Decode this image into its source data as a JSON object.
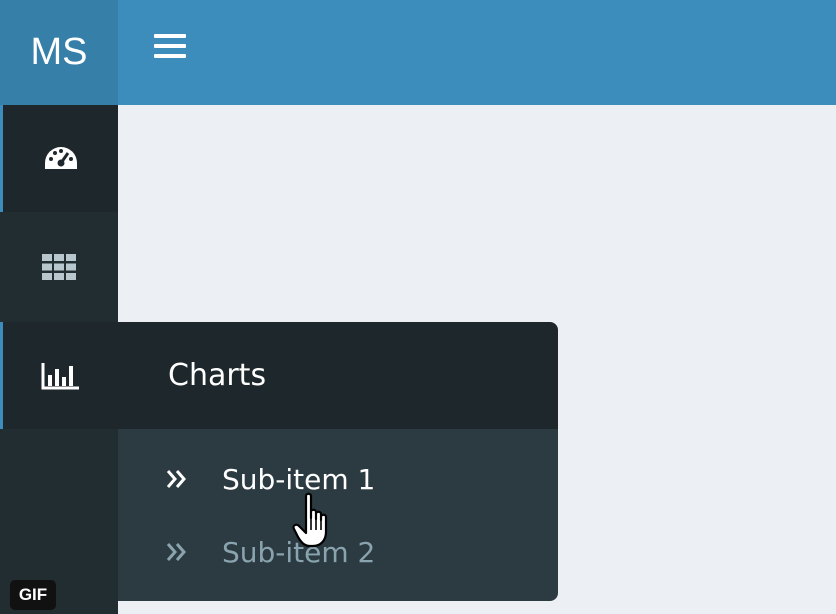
{
  "header": {
    "logo_text": "MS",
    "menu_icon": "hamburger-menu-icon"
  },
  "sidebar": {
    "items": [
      {
        "icon": "dashboard-gauge-icon",
        "active": true
      },
      {
        "icon": "grid-table-icon",
        "active": false
      },
      {
        "icon": "bar-chart-icon",
        "active": true
      }
    ]
  },
  "flyout": {
    "title": "Charts",
    "sub_items": [
      {
        "label": "Sub-item 1",
        "icon": "double-chevron-right-icon"
      },
      {
        "label": "Sub-item 2",
        "icon": "double-chevron-right-icon"
      }
    ]
  },
  "badge": {
    "label": "GIF"
  },
  "colors": {
    "header": "#3c8dbc",
    "logo_bg": "#367fa9",
    "sidebar": "#222d32",
    "sidebar_active": "#1e282c",
    "submenu": "#2c3b41",
    "content_bg": "#ecf0f5",
    "accent": "#3c8dbc"
  }
}
